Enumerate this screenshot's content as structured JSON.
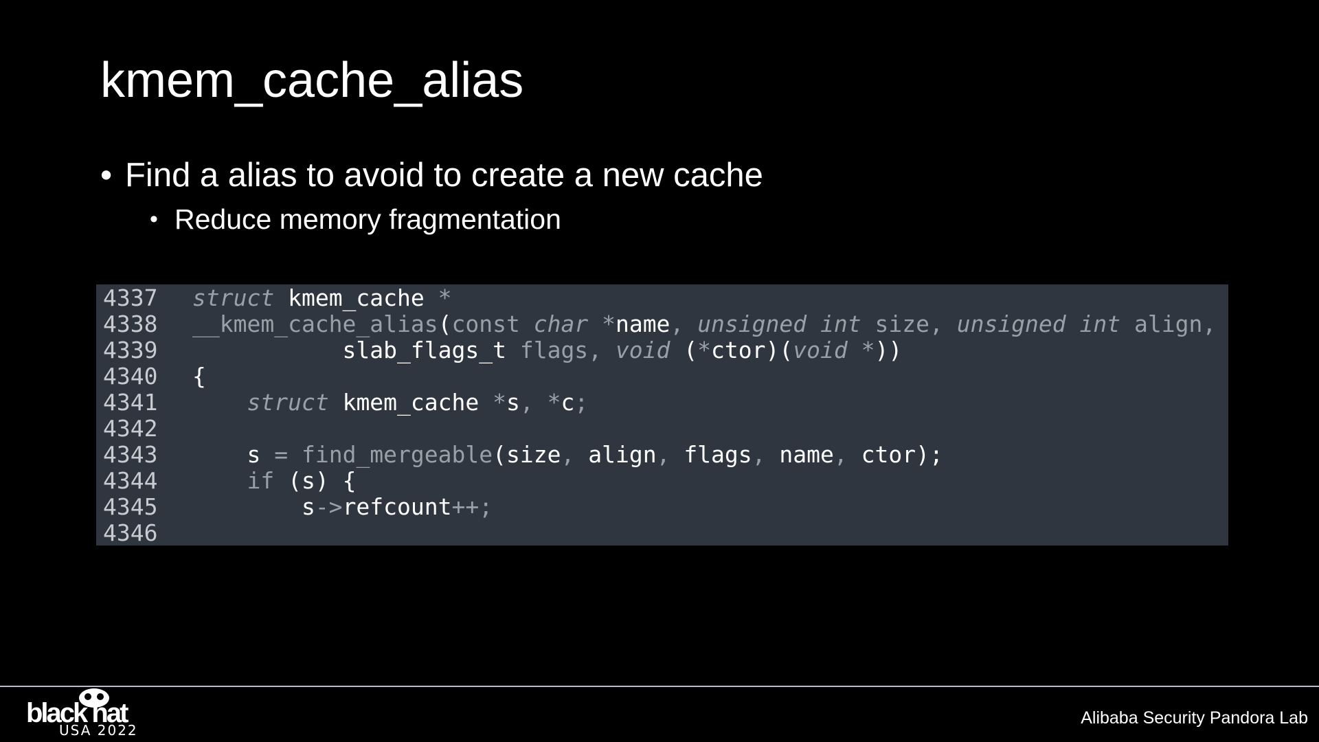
{
  "slide": {
    "title": "kmem_cache_alias",
    "bullets": [
      "Find a alias to avoid to create a new cache",
      "Reduce memory fragmentation"
    ]
  },
  "code": {
    "lines": [
      {
        "number": "4337",
        "tokens": [
          {
            "t": "struct",
            "c": "kw"
          },
          {
            "t": " kmem_cache ",
            "c": "id"
          },
          {
            "t": "*",
            "c": "op"
          }
        ]
      },
      {
        "number": "4338",
        "tokens": [
          {
            "t": "__kmem_cache_alias",
            "c": "fn"
          },
          {
            "t": "(",
            "c": "id"
          },
          {
            "t": "const",
            "c": "op"
          },
          {
            "t": " ",
            "c": "id"
          },
          {
            "t": "char",
            "c": "kw"
          },
          {
            "t": " ",
            "c": "id"
          },
          {
            "t": "*",
            "c": "op"
          },
          {
            "t": "name",
            "c": "id"
          },
          {
            "t": ", ",
            "c": "op"
          },
          {
            "t": "unsigned",
            "c": "kw"
          },
          {
            "t": " ",
            "c": "id"
          },
          {
            "t": "int",
            "c": "kw"
          },
          {
            "t": " size",
            "c": "op"
          },
          {
            "t": ", ",
            "c": "op"
          },
          {
            "t": "unsigned",
            "c": "kw"
          },
          {
            "t": " ",
            "c": "id"
          },
          {
            "t": "int",
            "c": "kw"
          },
          {
            "t": " align",
            "c": "op"
          },
          {
            "t": ",",
            "c": "op"
          }
        ]
      },
      {
        "number": "4339",
        "tokens": [
          {
            "t": "           slab_flags_t",
            "c": "id"
          },
          {
            "t": " flags",
            "c": "op"
          },
          {
            "t": ", ",
            "c": "op"
          },
          {
            "t": "void",
            "c": "kw"
          },
          {
            "t": " (",
            "c": "id"
          },
          {
            "t": "*",
            "c": "op"
          },
          {
            "t": "ctor)(",
            "c": "id"
          },
          {
            "t": "void",
            "c": "kw"
          },
          {
            "t": " ",
            "c": "id"
          },
          {
            "t": "*",
            "c": "op"
          },
          {
            "t": "))",
            "c": "id"
          }
        ]
      },
      {
        "number": "4340",
        "tokens": [
          {
            "t": "{",
            "c": "id"
          }
        ]
      },
      {
        "number": "4341",
        "tokens": [
          {
            "t": "    ",
            "c": "id"
          },
          {
            "t": "struct",
            "c": "kw"
          },
          {
            "t": " kmem_cache ",
            "c": "id"
          },
          {
            "t": "*",
            "c": "op"
          },
          {
            "t": "s",
            "c": "id"
          },
          {
            "t": ", ",
            "c": "op"
          },
          {
            "t": "*",
            "c": "op"
          },
          {
            "t": "c",
            "c": "id"
          },
          {
            "t": ";",
            "c": "op"
          }
        ]
      },
      {
        "number": "4342",
        "tokens": []
      },
      {
        "number": "4343",
        "tokens": [
          {
            "t": "    s ",
            "c": "id"
          },
          {
            "t": "=",
            "c": "op"
          },
          {
            "t": " ",
            "c": "id"
          },
          {
            "t": "find_mergeable",
            "c": "fn"
          },
          {
            "t": "(size",
            "c": "id"
          },
          {
            "t": ", ",
            "c": "op"
          },
          {
            "t": "align",
            "c": "id"
          },
          {
            "t": ", ",
            "c": "op"
          },
          {
            "t": "flags",
            "c": "id"
          },
          {
            "t": ", ",
            "c": "op"
          },
          {
            "t": "name",
            "c": "id"
          },
          {
            "t": ", ",
            "c": "op"
          },
          {
            "t": "ctor);",
            "c": "id"
          }
        ]
      },
      {
        "number": "4344",
        "tokens": [
          {
            "t": "    ",
            "c": "id"
          },
          {
            "t": "if",
            "c": "op"
          },
          {
            "t": " (s) {",
            "c": "id"
          }
        ]
      },
      {
        "number": "4345",
        "tokens": [
          {
            "t": "        s",
            "c": "id"
          },
          {
            "t": "->",
            "c": "op"
          },
          {
            "t": "refcount",
            "c": "id"
          },
          {
            "t": "++;",
            "c": "op"
          }
        ]
      },
      {
        "number": "4346",
        "tokens": []
      }
    ]
  },
  "footer": {
    "logo_word": "black hat",
    "logo_sub": "USA 2022",
    "credit": "Alibaba Security Pandora Lab"
  },
  "colors": {
    "background": "#000000",
    "code_panel": "#2f3640",
    "text": "#ffffff",
    "code_dim": "#9aa0a8"
  }
}
